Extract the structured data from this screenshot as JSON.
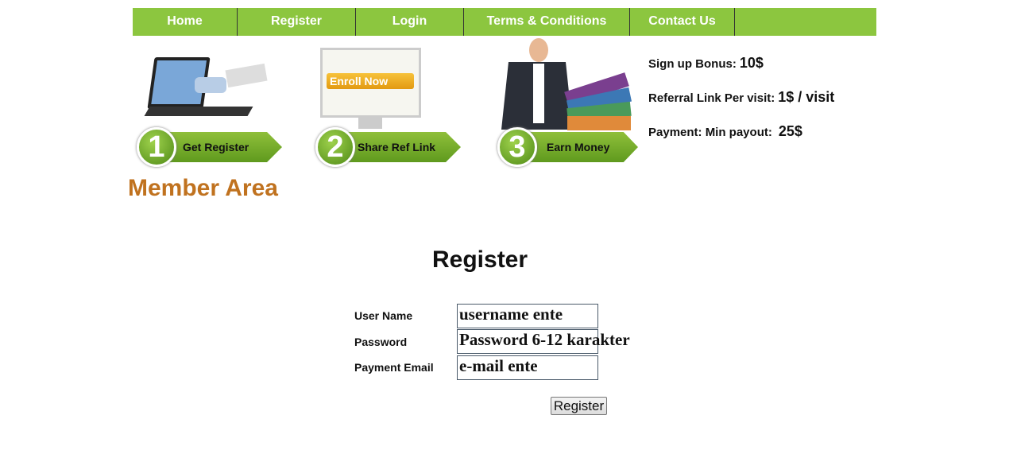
{
  "nav": {
    "items": [
      "Home",
      "Register",
      "Login",
      "Terms & Conditions",
      "Contact Us"
    ],
    "color": "#8cc63f"
  },
  "steps": [
    {
      "num": "1",
      "label": "Get Register"
    },
    {
      "num": "2",
      "label": "Share Ref Link"
    },
    {
      "num": "3",
      "label": "Earn Money"
    }
  ],
  "enroll_label": "Enroll Now",
  "info": [
    {
      "label": "Sign up Bonus:",
      "value": "10$"
    },
    {
      "label": "Referral Link Per visit:",
      "value": "1$ / visit"
    },
    {
      "label": "Payment: Min payout:",
      "value": "25$"
    }
  ],
  "member_area": "Member Area",
  "form": {
    "title": "Register",
    "fields": [
      {
        "label": "User Name",
        "value": "username ente"
      },
      {
        "label": "Password",
        "value": "Password 6-12 karakter"
      },
      {
        "label": "Payment Email",
        "value": "e-mail ente"
      }
    ],
    "submit": "Register"
  }
}
